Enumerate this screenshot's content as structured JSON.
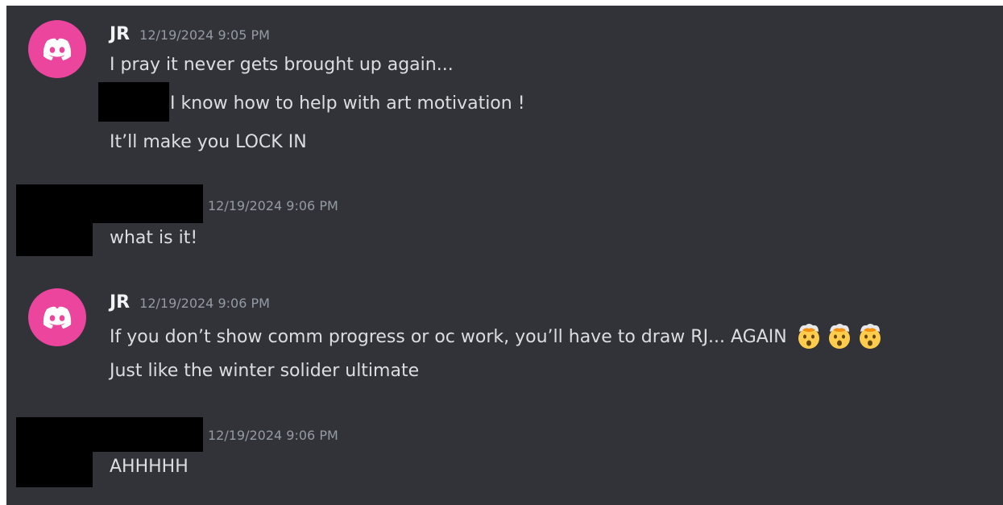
{
  "colors": {
    "background": "#313338",
    "avatar": "#eb459e",
    "text": "#dbdee1",
    "timestamp": "#949ba4",
    "username": "#f2f3f5"
  },
  "messages": [
    {
      "username": "JR",
      "timestamp": "12/19/2024 9:05 PM",
      "lines": [
        "I pray it never gets brought up again...",
        "I know how to help with art motivation !",
        "It’ll make you LOCK IN"
      ]
    },
    {
      "username": "",
      "timestamp": "12/19/2024 9:06 PM",
      "lines": [
        "what is it!"
      ]
    },
    {
      "username": "JR",
      "timestamp": "12/19/2024 9:06 PM",
      "lines": [
        "If you don’t show comm progress or oc work, you’ll have to draw RJ... AGAIN",
        "Just like the winter solider ultimate"
      ],
      "emoji": [
        "exploding-head-emoji",
        "exploding-head-emoji",
        "exploding-head-emoji"
      ]
    },
    {
      "username": "",
      "timestamp": "12/19/2024 9:06 PM",
      "lines": [
        "AHHHHH"
      ]
    }
  ]
}
